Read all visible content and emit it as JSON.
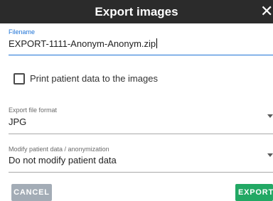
{
  "dialog": {
    "title": "Export images",
    "close_icon": "close-icon",
    "close_glyph": "✕"
  },
  "filename": {
    "label": "Filename",
    "value": "EXPORT-1111-Anonym-Anonym.zip"
  },
  "print_patient_data": {
    "label": "Print patient data to the images",
    "checked": false
  },
  "file_format": {
    "label": "Export file format",
    "value": "JPG"
  },
  "anonymization": {
    "label": "Modify patient data / anonymization",
    "value": "Do not modify patient data"
  },
  "actions": {
    "cancel_label": "CANCEL",
    "export_label": "EXPORT"
  },
  "colors": {
    "titlebar": "#2b2b2b",
    "focus_blue": "#1e73d6",
    "cancel_button": "#a3acb6",
    "export_button": "#22a864"
  }
}
